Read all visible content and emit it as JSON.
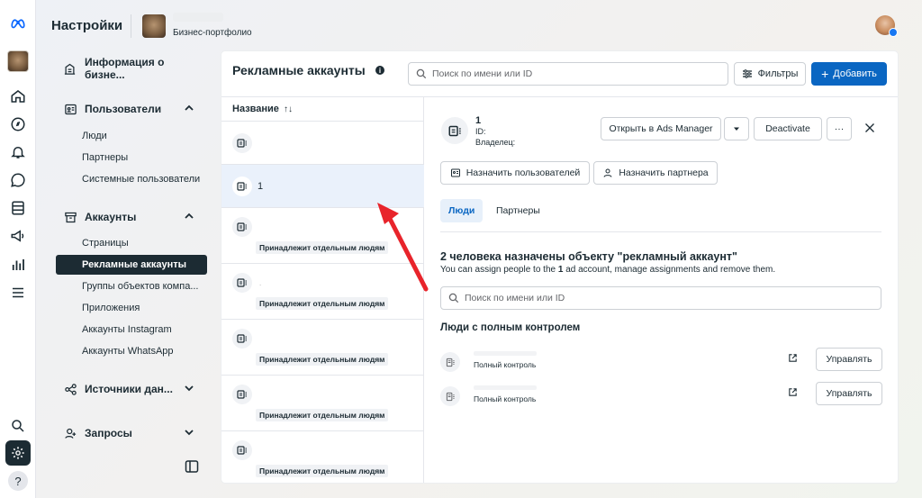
{
  "rail": {
    "icons": [
      "meta-logo-icon",
      "business-thumbnail",
      "home-icon",
      "compass-icon",
      "bell-icon",
      "chat-icon",
      "pages-icon",
      "megaphone-icon",
      "bar-chart-icon",
      "menu-icon",
      "search-icon",
      "gear-icon",
      "help-icon"
    ],
    "help_label": "?"
  },
  "header": {
    "title": "Настройки",
    "portfolio_label": "Бизнес-портфолио"
  },
  "sidebar": {
    "business_info": "Информация о бизне...",
    "users": {
      "label": "Пользователи",
      "items": [
        "Люди",
        "Партнеры",
        "Системные пользователи"
      ]
    },
    "accounts": {
      "label": "Аккаунты",
      "items": [
        "Страницы",
        "Рекламные аккаунты",
        "Группы объектов компа...",
        "Приложения",
        "Аккаунты Instagram",
        "Аккаунты WhatsApp"
      ],
      "active_index": 1
    },
    "data_sources": "Источники дан...",
    "requests": "Запросы"
  },
  "main": {
    "title": "Рекламные аккаунты",
    "info_glyph": "i",
    "search_placeholder": "Поиск по имени или ID",
    "filter_label": "Фильтры",
    "add_label": "Добавить",
    "list": {
      "column_header": "Название",
      "sort_glyph": "↑↓",
      "rows": [
        {
          "name": "",
          "tag": ""
        },
        {
          "name": "1",
          "tag": ""
        },
        {
          "name": "",
          "tag": "Принадлежит отдельным людям"
        },
        {
          "name": ".",
          "tag": "Принадлежит отдельным людям"
        },
        {
          "name": "",
          "tag": "Принадлежит отдельным людям"
        },
        {
          "name": "",
          "tag": "Принадлежит отдельным людям"
        },
        {
          "name": "",
          "tag": "Принадлежит отдельным людям"
        }
      ],
      "selected_index": 1
    },
    "detail": {
      "name": "1",
      "id_label": "ID:",
      "owner_label": "Владелец:",
      "open_ads_manager": "Открыть в Ads Manager",
      "deactivate": "Deactivate",
      "more_glyph": "···",
      "assign_users": "Назначить пользователей",
      "assign_partner": "Назначить партнера",
      "tabs": [
        "Люди",
        "Партнеры"
      ],
      "assigned_title": "2 человека назначены объекту \"рекламный аккаунт\"",
      "assigned_sub_before": "You can assign people to the ",
      "assigned_sub_bold": "1",
      "assigned_sub_after": " ad account, manage assignments and remove them.",
      "people_search_placeholder": "Поиск по имени или ID",
      "full_control_title": "Люди с полным контролем",
      "people": [
        {
          "role": "Полный контроль",
          "manage": "Управлять"
        },
        {
          "role": "Полный контроль",
          "manage": "Управлять"
        }
      ]
    }
  },
  "colors": {
    "primary": "#0a66c2",
    "text": "#1c2b33",
    "selected_row": "#eaf1fb",
    "annotation_arrow": "#e8242b"
  }
}
